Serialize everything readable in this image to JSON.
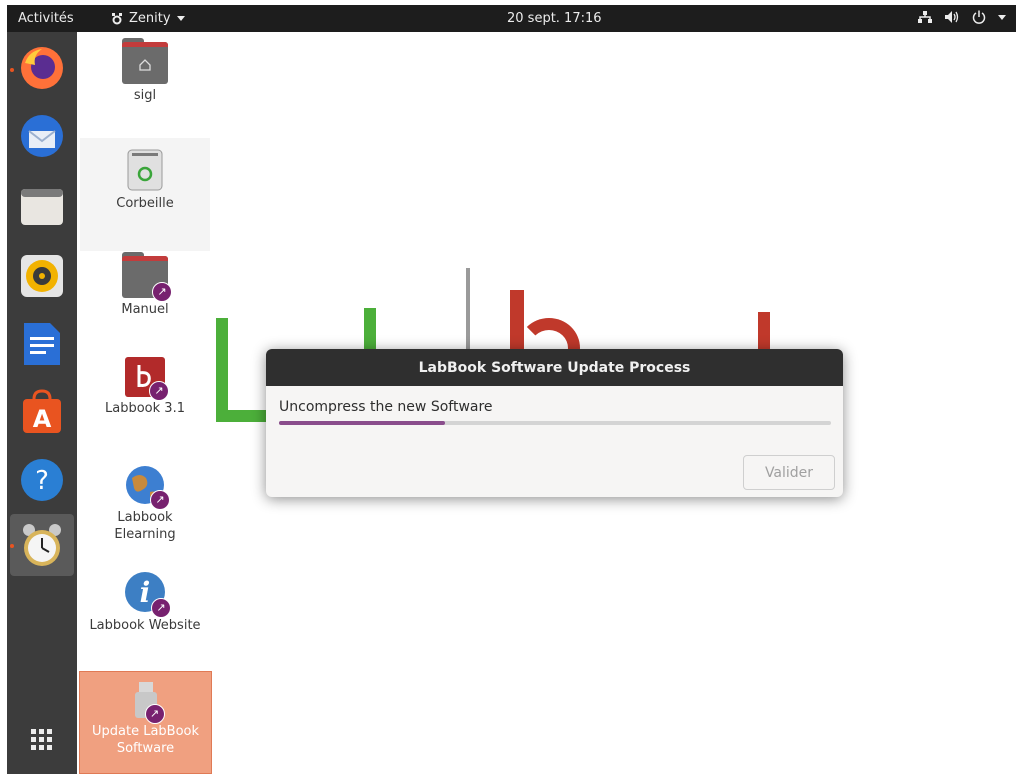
{
  "topbar": {
    "activities": "Activités",
    "app_name": "Zenity",
    "clock": "20 sept.  17:16",
    "tray": [
      "network-icon",
      "volume-icon",
      "power-icon"
    ]
  },
  "dock": {
    "items": [
      "firefox-icon",
      "thunderbird-icon",
      "files-icon",
      "rhythmbox-icon",
      "writer-icon",
      "software-center-icon",
      "help-icon",
      "alarm-clock-icon"
    ],
    "show_apps": "show-applications-icon"
  },
  "desktop": {
    "icons": [
      {
        "label": "sigl",
        "icon": "home-folder-icon"
      },
      {
        "label": "Corbeille",
        "icon": "trash-icon"
      },
      {
        "label": "Manuel",
        "icon": "folder-link-icon"
      },
      {
        "label": "Labbook 3.1",
        "icon": "labbook-app-icon"
      },
      {
        "label": "Labbook\nElearning",
        "icon": "globe-link-icon"
      },
      {
        "label": "Labbook Website",
        "icon": "info-link-icon"
      },
      {
        "label": "Update LabBook\nSoftware",
        "icon": "usb-link-icon"
      }
    ]
  },
  "dialog": {
    "title": "LabBook Software Update Process",
    "message": "Uncompress the new Software",
    "progress": 0.3,
    "ok_label": "Valider"
  },
  "colors": {
    "accent_purple": "#77216f",
    "progress_fill": "#8a4d8c",
    "selection": "#f0a080",
    "logo_green": "#4caf3a",
    "logo_red": "#c0392b"
  }
}
